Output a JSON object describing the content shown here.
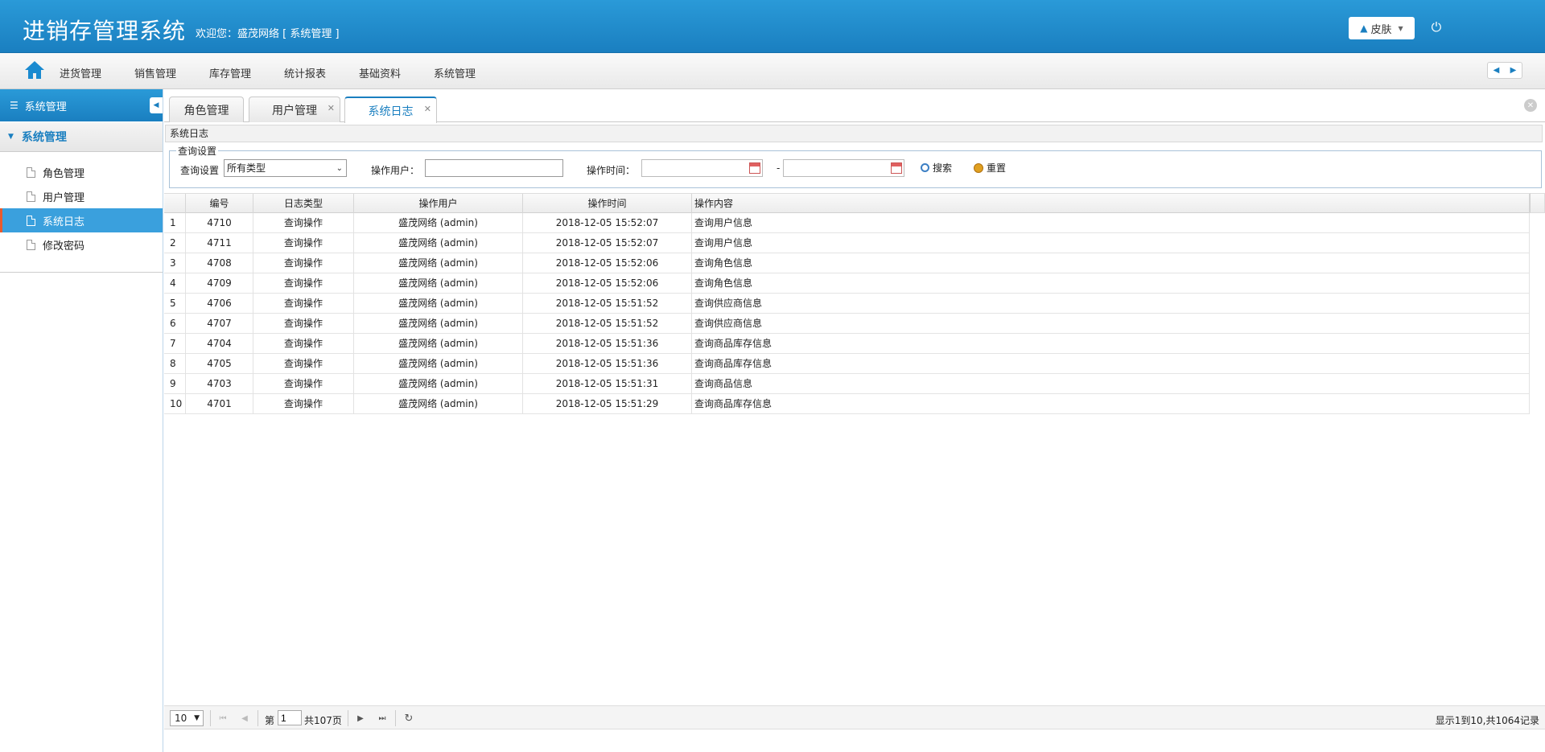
{
  "header": {
    "title": "进销存管理系统",
    "welcome": "欢迎您：盛茂网络 [ 系统管理 ]",
    "skin_label": "皮肤"
  },
  "menu": {
    "items": [
      "进货管理",
      "销售管理",
      "库存管理",
      "统计报表",
      "基础资料",
      "系统管理"
    ]
  },
  "sidebar": {
    "title": "系统管理",
    "group": "系统管理",
    "items": [
      {
        "label": "角色管理"
      },
      {
        "label": "用户管理"
      },
      {
        "label": "系统日志"
      },
      {
        "label": "修改密码"
      }
    ],
    "active_index": 2
  },
  "tabs": [
    {
      "label": "角色管理"
    },
    {
      "label": "用户管理"
    },
    {
      "label": "系统日志"
    }
  ],
  "panel": {
    "title": "系统日志"
  },
  "query": {
    "legend": "查询设置",
    "type_label": "查询设置",
    "type_value": "所有类型",
    "user_label": "操作用户：",
    "user_value": "",
    "time_label": "操作时间：",
    "dash": "-",
    "search_label": "搜索",
    "reset_label": "重置"
  },
  "grid": {
    "columns": [
      "编号",
      "日志类型",
      "操作用户",
      "操作时间",
      "操作内容"
    ],
    "rows": [
      {
        "n": "1",
        "id": "4710",
        "type": "查询操作",
        "user": "盛茂网络 (admin)",
        "time": "2018-12-05 15:52:07",
        "content": "查询用户信息"
      },
      {
        "n": "2",
        "id": "4711",
        "type": "查询操作",
        "user": "盛茂网络 (admin)",
        "time": "2018-12-05 15:52:07",
        "content": "查询用户信息"
      },
      {
        "n": "3",
        "id": "4708",
        "type": "查询操作",
        "user": "盛茂网络 (admin)",
        "time": "2018-12-05 15:52:06",
        "content": "查询角色信息"
      },
      {
        "n": "4",
        "id": "4709",
        "type": "查询操作",
        "user": "盛茂网络 (admin)",
        "time": "2018-12-05 15:52:06",
        "content": "查询角色信息"
      },
      {
        "n": "5",
        "id": "4706",
        "type": "查询操作",
        "user": "盛茂网络 (admin)",
        "time": "2018-12-05 15:51:52",
        "content": "查询供应商信息"
      },
      {
        "n": "6",
        "id": "4707",
        "type": "查询操作",
        "user": "盛茂网络 (admin)",
        "time": "2018-12-05 15:51:52",
        "content": "查询供应商信息"
      },
      {
        "n": "7",
        "id": "4704",
        "type": "查询操作",
        "user": "盛茂网络 (admin)",
        "time": "2018-12-05 15:51:36",
        "content": "查询商品库存信息"
      },
      {
        "n": "8",
        "id": "4705",
        "type": "查询操作",
        "user": "盛茂网络 (admin)",
        "time": "2018-12-05 15:51:36",
        "content": "查询商品库存信息"
      },
      {
        "n": "9",
        "id": "4703",
        "type": "查询操作",
        "user": "盛茂网络 (admin)",
        "time": "2018-12-05 15:51:31",
        "content": "查询商品信息"
      },
      {
        "n": "10",
        "id": "4701",
        "type": "查询操作",
        "user": "盛茂网络 (admin)",
        "time": "2018-12-05 15:51:29",
        "content": "查询商品库存信息"
      }
    ]
  },
  "pager": {
    "page_size": "10",
    "page_prefix": "第",
    "page_value": "1",
    "page_total": "共107页",
    "info": "显示1到10,共1064记录"
  },
  "colors": {
    "accent": "#1a7fc0",
    "active_item": "#3aa0dd",
    "active_marker": "#e85a2c"
  }
}
